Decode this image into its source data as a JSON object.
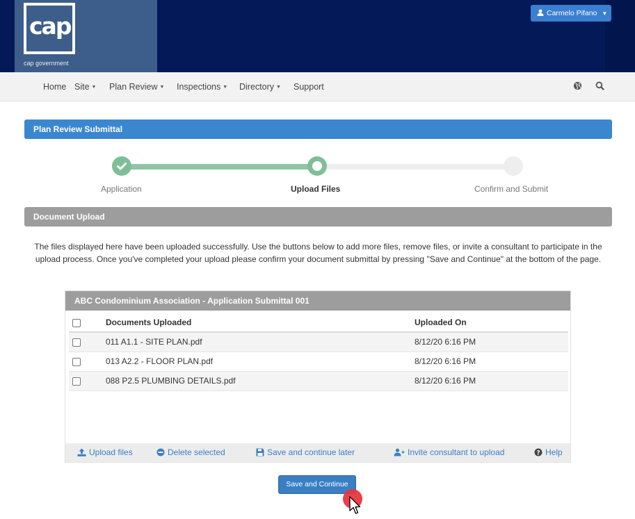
{
  "header": {
    "logo_text": "cap",
    "tagline": "cap government",
    "user_name": "Carmelo Pifano"
  },
  "nav": {
    "items": [
      {
        "label": "Home",
        "dropdown": false
      },
      {
        "label": "Site",
        "dropdown": true
      },
      {
        "label": "Plan Review",
        "dropdown": true
      },
      {
        "label": "Inspections",
        "dropdown": true
      },
      {
        "label": "Directory",
        "dropdown": true
      },
      {
        "label": "Support",
        "dropdown": false
      }
    ],
    "icons": [
      "globe-icon",
      "search-icon"
    ]
  },
  "page": {
    "title": "Plan Review Submittal"
  },
  "stepper": {
    "steps": [
      {
        "label": "Application",
        "state": "complete"
      },
      {
        "label": "Upload Files",
        "state": "current"
      },
      {
        "label": "Confirm and Submit",
        "state": "pending"
      }
    ],
    "progress_fraction": 0.5
  },
  "upload": {
    "section_title": "Document Upload",
    "instructions": "The files displayed here have been uploaded successfully. Use the buttons below to add more files, remove files, or invite a consultant to participate in the upload process. Once you've completed your upload please confirm your document submittal by pressing \"Save and Continue\" at the bottom of the page."
  },
  "panel": {
    "title": "ABC Condominium Association - Application Submittal 001",
    "columns": [
      "Documents Uploaded",
      "Uploaded On"
    ],
    "rows": [
      {
        "name": "011 A1.1 - SITE PLAN.pdf",
        "date": "8/12/20 6:16 PM",
        "checked": false
      },
      {
        "name": "013 A2.2 - FLOOR PLAN.pdf",
        "date": "8/12/20 6:16 PM",
        "checked": false
      },
      {
        "name": "088 P2.5 PLUMBING DETAILS.pdf",
        "date": "8/12/20 6:16 PM",
        "checked": false
      }
    ],
    "actions": {
      "upload": "Upload files",
      "delete": "Delete selected",
      "save_later": "Save and continue later",
      "invite": "Invite consultant to upload",
      "help": "Help"
    }
  },
  "primary_button": "Save and Continue",
  "colors": {
    "header_bg": "#031958",
    "brand_bg": "#3d5e8a",
    "accent_blue": "#3a87d0",
    "section_gray": "#9d9d9d",
    "step_green": "#7fbf98",
    "link_blue": "#3a7fc4",
    "click_indicator": "#e8363f"
  }
}
